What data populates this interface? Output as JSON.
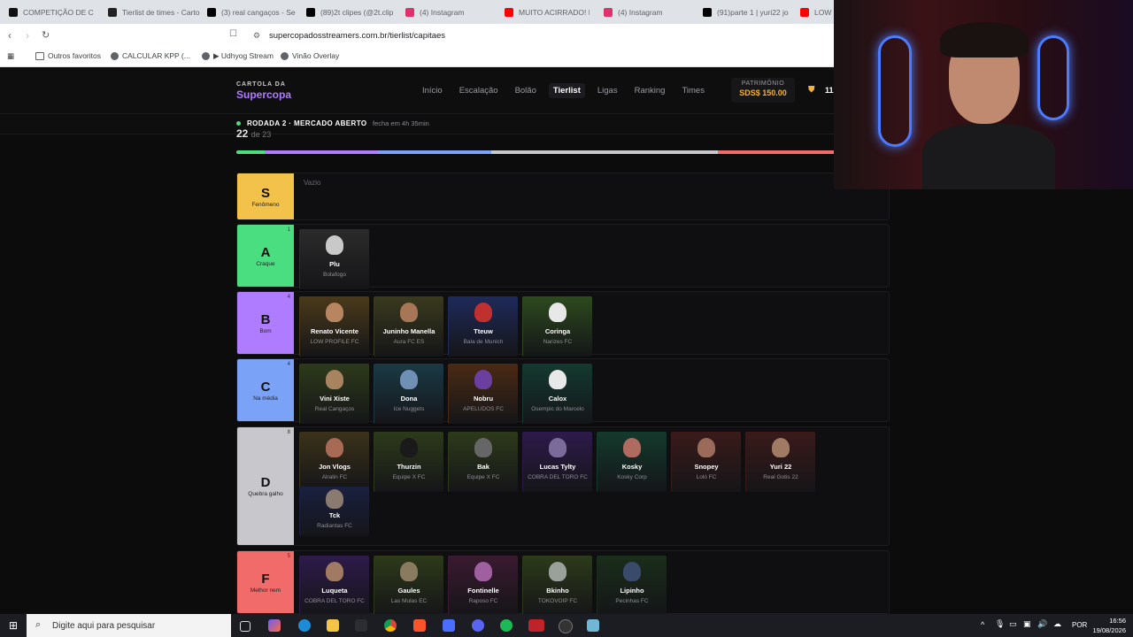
{
  "browser": {
    "tabs": [
      {
        "title": "COMPETIÇÃO DE CO",
        "color": "#111111"
      },
      {
        "title": "Tierlist de times - Carto",
        "color": "#222222"
      },
      {
        "title": "(3) real cangaços - Sea",
        "color": "#000000"
      },
      {
        "title": "(89)2t clipes (@2t.clip",
        "color": "#000000"
      },
      {
        "title": "(4) Instagram",
        "color": "#e1306c"
      },
      {
        "title": "MUITO ACIRRADO! FA",
        "color": "#ff0000"
      },
      {
        "title": "(4) Instagram",
        "color": "#e1306c"
      },
      {
        "title": "(91)parte 1 | yuri22 jo",
        "color": "#000000"
      },
      {
        "title": "LOW P",
        "color": "#ff0000"
      }
    ],
    "url": "supercopadosstreamers.com.br/tierlist/capitaes",
    "bookmarks": [
      "Outros favoritos",
      "CALCULAR KPP (...",
      "▶ Udhyog Stream",
      "Vinão Overlay"
    ]
  },
  "site": {
    "logo_top": "CARTOLA DA",
    "logo_main": "Supercopa",
    "nav": [
      "Início",
      "Escalação",
      "Bolão",
      "Tierlist",
      "Ligas",
      "Ranking",
      "Times"
    ],
    "active_nav": "Tierlist",
    "patrimonio_label": "PATRIMÔNIO",
    "patrimonio_value": "SDS$ 150.00",
    "user_short": "11",
    "rodada": "RODADA 2 · MERCADO ABERTO",
    "fecha": "fecha em 4h 35min",
    "progress_count": "22",
    "progress_total": "de 23"
  },
  "tiers": [
    {
      "letter": "S",
      "name": "Fenômeno",
      "count": "",
      "color": "#f2c24a",
      "empty_label": "Vazio",
      "cards": []
    },
    {
      "letter": "A",
      "name": "Craque",
      "count": "1",
      "color": "#4ade80",
      "cards": [
        {
          "name": "Plu",
          "team": "Botafogo",
          "accent": "#2b2b2b",
          "skin": "#c9c9c9"
        }
      ]
    },
    {
      "letter": "B",
      "name": "Bom",
      "count": "4",
      "color": "#b07cff",
      "cards": [
        {
          "name": "Renato Vicente",
          "team": "LOW PROFILE FC",
          "accent": "#4a3a1a",
          "skin": "#b78560"
        },
        {
          "name": "Juninho Manella",
          "team": "Aura FC ES",
          "accent": "#3a3a1e",
          "skin": "#a77656"
        },
        {
          "name": "Tteuw",
          "team": "Bala de Munich",
          "accent": "#1f2a5a",
          "skin": "#c0302f"
        },
        {
          "name": "Coringa",
          "team": "Narizes FC",
          "accent": "#2d4a1e",
          "skin": "#e8e8e8"
        }
      ]
    },
    {
      "letter": "C",
      "name": "Na média",
      "count": "4",
      "color": "#7aa2f7",
      "cards": [
        {
          "name": "Vini Xiste",
          "team": "Real Cangaços",
          "accent": "#2d3a1a",
          "skin": "#a88360"
        },
        {
          "name": "Dona",
          "team": "Ice Nuggets",
          "accent": "#1a3a45",
          "skin": "#6f8fb5"
        },
        {
          "name": "Nobru",
          "team": "APELUDOS FC",
          "accent": "#4a2a14",
          "skin": "#6b3fa0"
        },
        {
          "name": "Calox",
          "team": "Osempic do Marcelo",
          "accent": "#143a30",
          "skin": "#e8e8e8"
        }
      ]
    },
    {
      "letter": "D",
      "name": "Quebra galho",
      "count": "8",
      "color": "#c8c8cc",
      "cards": [
        {
          "name": "Jon Vlogs",
          "team": "Alralin FC",
          "accent": "#3a321a",
          "skin": "#a86a55"
        },
        {
          "name": "Thurzin",
          "team": "Equipe X FC",
          "accent": "#2d3a1a",
          "skin": "#1a1a1a"
        },
        {
          "name": "Bak",
          "team": "Equipe X FC",
          "accent": "#2d3a1a",
          "skin": "#666666"
        },
        {
          "name": "Lucas Tylty",
          "team": "COBRA DEL TORO FC",
          "accent": "#2d1a4a",
          "skin": "#7a6b9a"
        },
        {
          "name": "Kosky",
          "team": "Kosky Corp",
          "accent": "#143a2d",
          "skin": "#b06a60"
        },
        {
          "name": "Snopey",
          "team": "Loló FC",
          "accent": "#3a1a1a",
          "skin": "#9a6a5a"
        },
        {
          "name": "Yuri 22",
          "team": "Real Gotis 22",
          "accent": "#3a1a1a",
          "skin": "#a07a62"
        },
        {
          "name": "Tck",
          "team": "Radiantas FC",
          "accent": "#1a2040",
          "skin": "#8a7a70"
        }
      ]
    },
    {
      "letter": "F",
      "name": "Melhor nem",
      "count": "5",
      "color": "#f26b6b",
      "cards": [
        {
          "name": "Luqueta",
          "team": "COBRA DEL TORO FC",
          "accent": "#2d1a4a",
          "skin": "#a07a62"
        },
        {
          "name": "Gaules",
          "team": "Las Mulas EC",
          "accent": "#2d3a1a",
          "skin": "#8a7a60"
        },
        {
          "name": "Fontinelle",
          "team": "Raposo FC",
          "accent": "#3a1a30",
          "skin": "#a060a0"
        },
        {
          "name": "Bkinho",
          "team": "TOKOVOIP FC",
          "accent": "#2d3a1a",
          "skin": "#9aa09a"
        },
        {
          "name": "Lipinho",
          "team": "Pecinhas FC",
          "accent": "#1a2d1a",
          "skin": "#3a4a6a"
        }
      ]
    }
  ],
  "taskbar": {
    "search_placeholder": "Digite aqui para pesquisar",
    "lang": "POR",
    "time": "16:56",
    "date": "19/08/2026"
  }
}
